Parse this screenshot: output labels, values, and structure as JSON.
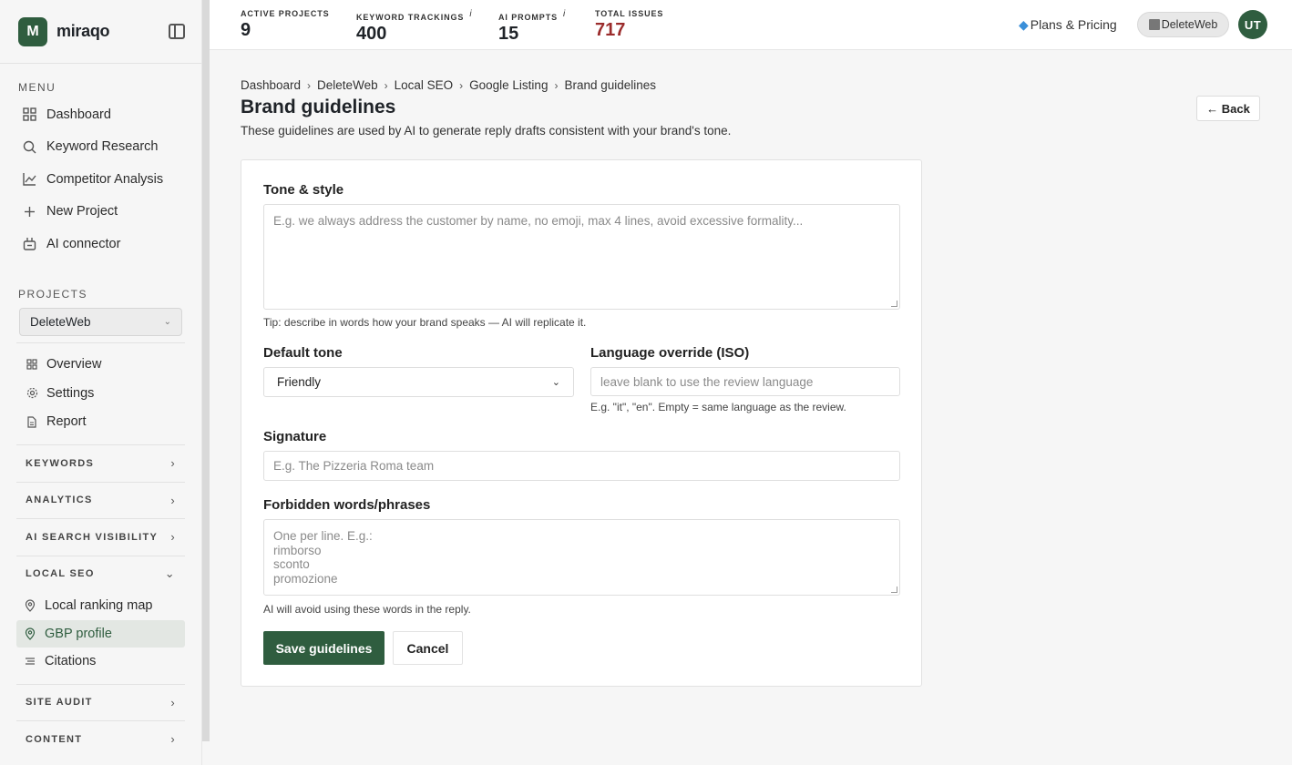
{
  "brand": {
    "mark": "M",
    "name": "miraqo"
  },
  "sidebar": {
    "menu_label": "MENU",
    "menu_items": [
      {
        "label": "Dashboard",
        "icon": "grid-icon"
      },
      {
        "label": "Keyword Research",
        "icon": "search-icon"
      },
      {
        "label": "Competitor Analysis",
        "icon": "chart-line-icon"
      },
      {
        "label": "New Project",
        "icon": "plus-icon"
      },
      {
        "label": "AI connector",
        "icon": "plug-icon"
      }
    ],
    "projects_label": "PROJECTS",
    "project_selected": "DeleteWeb",
    "project_items": [
      {
        "label": "Overview",
        "icon": "grid-icon"
      },
      {
        "label": "Settings",
        "icon": "gear-icon"
      },
      {
        "label": "Report",
        "icon": "document-icon"
      }
    ],
    "groups": {
      "keywords": "KEYWORDS",
      "analytics": "ANALYTICS",
      "ai_search": "AI SEARCH VISIBILITY",
      "local_seo": "LOCAL SEO",
      "site_audit": "SITE AUDIT",
      "content": "CONTENT"
    },
    "local_seo_items": [
      {
        "label": "Local ranking map",
        "icon": "pin-icon"
      },
      {
        "label": "GBP profile",
        "icon": "pin-icon",
        "active": true
      },
      {
        "label": "Citations",
        "icon": "list-icon"
      }
    ]
  },
  "topbar": {
    "stats": [
      {
        "label": "ACTIVE PROJECTS",
        "value": "9",
        "info": ""
      },
      {
        "label": "KEYWORD TRACKINGS",
        "value": "400",
        "info": "i"
      },
      {
        "label": "AI PROMPTS",
        "value": "15",
        "info": "i"
      },
      {
        "label": "TOTAL ISSUES",
        "value": "717",
        "info": ""
      }
    ],
    "plans_label": "Plans & Pricing",
    "workspace": "DeleteWeb",
    "avatar_initials": "UT"
  },
  "breadcrumb": [
    "Dashboard",
    "DeleteWeb",
    "Local SEO",
    "Google Listing",
    "Brand guidelines"
  ],
  "page": {
    "title": "Brand guidelines",
    "subtitle": "These guidelines are used by AI to generate reply drafts consistent with your brand's tone.",
    "back_label": "← Back"
  },
  "form": {
    "tone_label": "Tone & style",
    "tone_placeholder": "E.g. we always address the customer by name, no emoji, max 4 lines, avoid excessive formality...",
    "tone_hint": "Tip: describe in words how your brand speaks — AI will replicate it.",
    "default_tone_label": "Default tone",
    "default_tone_value": "Friendly",
    "language_label": "Language override (ISO)",
    "language_placeholder": "leave blank to use the review language",
    "language_hint": "E.g. \"it\", \"en\". Empty = same language as the review.",
    "signature_label": "Signature",
    "signature_placeholder": "E.g. The Pizzeria Roma team",
    "forbidden_label": "Forbidden words/phrases",
    "forbidden_placeholder": "One per line. E.g.:\nrimborso\nsconto\npromozione",
    "forbidden_hint": "AI will avoid using these words in the reply.",
    "save_label": "Save guidelines",
    "cancel_label": "Cancel"
  },
  "colors": {
    "accent": "#2f5d3f",
    "issues": "#9b2c2c"
  }
}
